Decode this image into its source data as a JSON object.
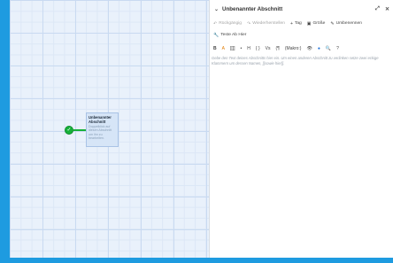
{
  "story_map": {
    "passage": {
      "title": "Unbenannter Abschnitt",
      "excerpt": "Doppelklick auf diesen Abschnitt um ihn zu bearbeiten."
    },
    "start_marker_icon": "rocket-icon"
  },
  "dialog": {
    "title": "Unbenannter Abschnitt",
    "collapse_icon": "chevron-down-icon",
    "maximize_icon": "expand-icon",
    "close_icon": "close-icon",
    "toolbar": {
      "undo": "Rückgängig",
      "redo": "Wiederherstellen",
      "tag": "Tag",
      "size": "Größe",
      "rename": "Umbenennen",
      "test_from_here": "Teste Ab Hier"
    },
    "format_bar": {
      "bold": "B",
      "color": "A",
      "link": "[[]]",
      "list": "•",
      "heading": "H",
      "braces": "{ }",
      "vars": "Vs",
      "hooks": "(¶",
      "macro": "(Makro:)"
    },
    "editor_placeholder": "Gebe den Text deines Abschnitts hier ein. Um einen anderen Abschnitt zu verlinken setze zwei eckige Klammern um dessen Namen, [[sowie hier]]."
  }
}
